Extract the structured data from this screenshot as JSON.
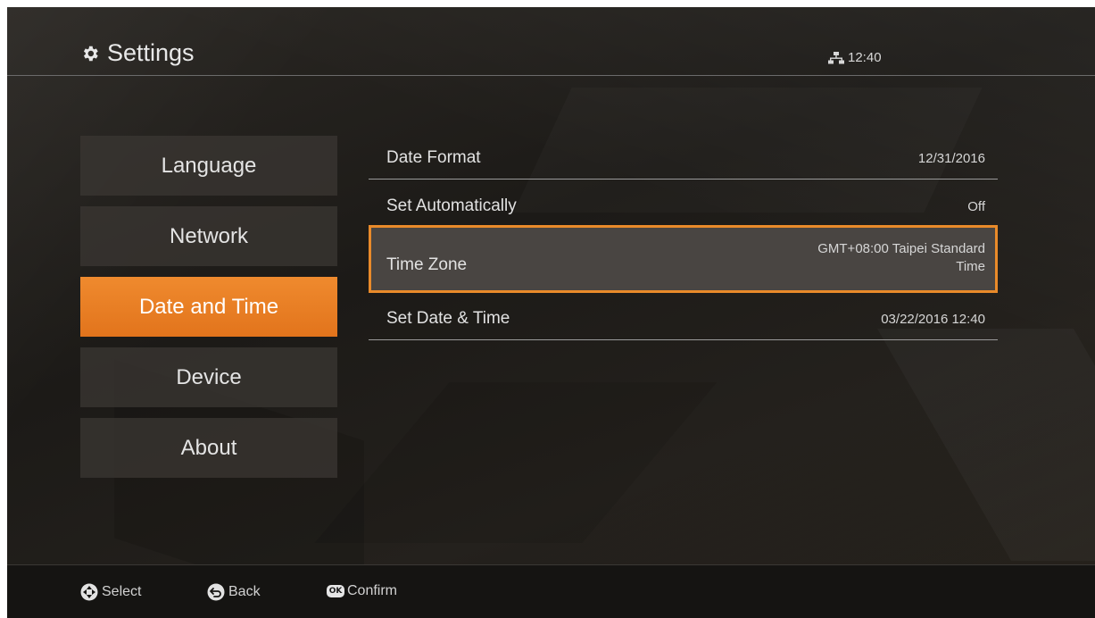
{
  "header": {
    "title": "Settings",
    "title_icon": "gear-icon",
    "network_icon": "network-icon",
    "clock": "12:40"
  },
  "menu": {
    "items": [
      {
        "label": "Language",
        "active": false
      },
      {
        "label": "Network",
        "active": false
      },
      {
        "label": "Date and Time",
        "active": true
      },
      {
        "label": "Device",
        "active": false
      },
      {
        "label": "About",
        "active": false
      }
    ]
  },
  "settings": {
    "rows": [
      {
        "label": "Date Format",
        "value": "12/31/2016",
        "selected": false
      },
      {
        "label": "Set Automatically",
        "value": "Off",
        "selected": false
      },
      {
        "label": "Time Zone",
        "value_line1": "GMT+08:00 Taipei Standard",
        "value_line2": "Time",
        "selected": true
      },
      {
        "label": "Set Date & Time",
        "value": "03/22/2016 12:40",
        "selected": false
      }
    ]
  },
  "footer": {
    "select_label": "Select",
    "back_label": "Back",
    "ok_badge": "OK",
    "confirm_label": "Confirm"
  },
  "colors": {
    "accent": "#e98a2a",
    "active_menu": "#ec8229",
    "background": "#22201c"
  }
}
